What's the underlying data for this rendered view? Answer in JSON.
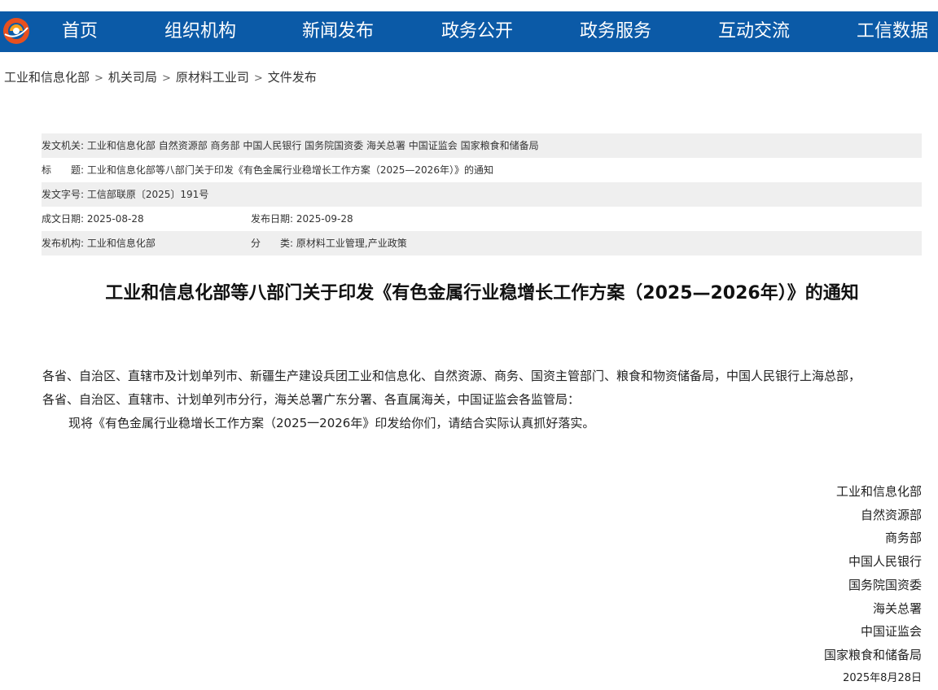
{
  "nav": {
    "items": [
      {
        "label": "首页"
      },
      {
        "label": "组织机构"
      },
      {
        "label": "新闻发布"
      },
      {
        "label": "政务公开"
      },
      {
        "label": "政务服务"
      },
      {
        "label": "互动交流"
      },
      {
        "label": "工信数据"
      }
    ],
    "bar_color": "#0b5aa7",
    "logo_icon": "ministry-logo-icon"
  },
  "breadcrumb": {
    "items": [
      "工业和信息化部",
      "机关司局",
      "原材料工业司",
      "文件发布"
    ],
    "separator": ">"
  },
  "meta": {
    "issuer_label": "发文机关:",
    "issuer_value": "工业和信息化部 自然资源部 商务部 中国人民银行 国务院国资委 海关总署 中国证监会 国家粮食和储备局",
    "title_label": "标　　题:",
    "title_value": "工业和信息化部等八部门关于印发《有色金属行业稳增长工作方案（2025—2026年）》的通知",
    "docno_label": "发文字号:",
    "docno_value": "工信部联原〔2025〕191号",
    "created_label": "成文日期:",
    "created_value": "2025-08-28",
    "published_label": "发布日期:",
    "published_value": "2025-09-28",
    "org_label": "发布机构:",
    "org_value": "工业和信息化部",
    "category_label": "分　　类:",
    "category_value": "原材料工业管理,产业政策"
  },
  "document": {
    "title": "工业和信息化部等八部门关于印发《有色金属行业稳增长工作方案（2025—2026年）》的通知",
    "addressees_line1": "各省、自治区、直辖市及计划单列市、新疆生产建设兵团工业和信息化、自然资源、商务、国资主管部门、粮食和物资储备局，中国人民银行上海总部，",
    "addressees_line2": "各省、自治区、直辖市、计划单列市分行，海关总署广东分署、各直属海关，中国证监会各监管局：",
    "body": "现将《有色金属行业稳增长工作方案（2025一2026年》印发给你们，请结合实际认真抓好落实。",
    "signers": [
      "工业和信息化部",
      "自然资源部",
      "商务部",
      "中国人民银行",
      "国务院国资委",
      "海关总署",
      "中国证监会",
      "国家粮食和储备局"
    ],
    "date": "2025年8月28日"
  }
}
